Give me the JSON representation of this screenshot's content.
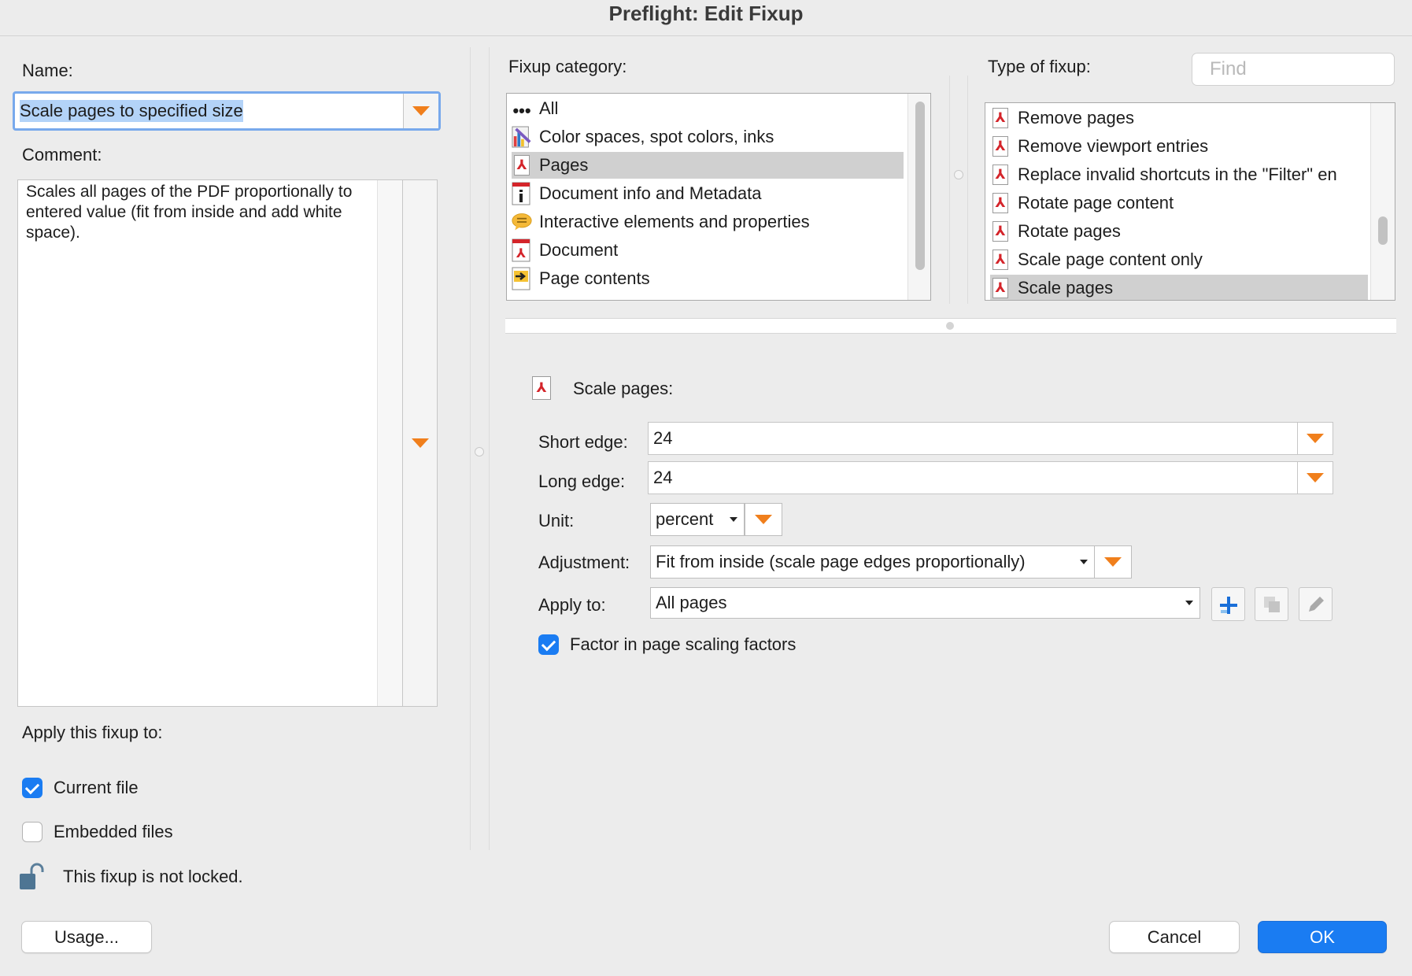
{
  "window": {
    "title": "Preflight: Edit Fixup"
  },
  "name": {
    "label": "Name:",
    "value": "Scale pages to specified size"
  },
  "comment": {
    "label": "Comment:",
    "value": "Scales all pages of the PDF proportionally to entered value (fit from inside and add white space)."
  },
  "apply_fixup": {
    "label": "Apply this fixup to:",
    "current_file": {
      "label": "Current file",
      "checked": true
    },
    "embedded_files": {
      "label": "Embedded files",
      "checked": false
    }
  },
  "lock_status": "This fixup is not locked.",
  "category": {
    "label": "Fixup category:",
    "items": [
      {
        "label": "All",
        "icon": "ellipsis-icon"
      },
      {
        "label": "Color spaces, spot colors, inks",
        "icon": "color-icon"
      },
      {
        "label": "Pages",
        "icon": "pdf-icon",
        "selected": true
      },
      {
        "label": "Document info and Metadata",
        "icon": "info-icon"
      },
      {
        "label": "Interactive elements and properties",
        "icon": "comment-icon"
      },
      {
        "label": "Document",
        "icon": "pdf-icon"
      },
      {
        "label": "Page contents",
        "icon": "arrow-icon"
      }
    ]
  },
  "type": {
    "label": "Type of fixup:",
    "search_placeholder": "Find",
    "items": [
      {
        "label": "Remove pages"
      },
      {
        "label": "Remove viewport entries"
      },
      {
        "label": "Replace invalid shortcuts in the \"Filter\" en"
      },
      {
        "label": "Rotate page content"
      },
      {
        "label": "Rotate pages"
      },
      {
        "label": "Scale page content only"
      },
      {
        "label": "Scale pages",
        "selected": true
      }
    ]
  },
  "params": {
    "heading": "Scale pages:",
    "short_edge": {
      "label": "Short edge:",
      "value": "24"
    },
    "long_edge": {
      "label": "Long edge:",
      "value": "24"
    },
    "unit": {
      "label": "Unit:",
      "value": "percent"
    },
    "adjustment": {
      "label": "Adjustment:",
      "value": "Fit from inside (scale page edges proportionally)"
    },
    "apply_to": {
      "label": "Apply to:",
      "value": "All pages"
    },
    "factor": {
      "label": "Factor in page scaling factors",
      "checked": true
    }
  },
  "buttons": {
    "usage": "Usage...",
    "cancel": "Cancel",
    "ok": "OK"
  },
  "colors": {
    "accent": "#1a7cf2",
    "orange": "#f07f1c",
    "selection": "#b3d3f8"
  }
}
